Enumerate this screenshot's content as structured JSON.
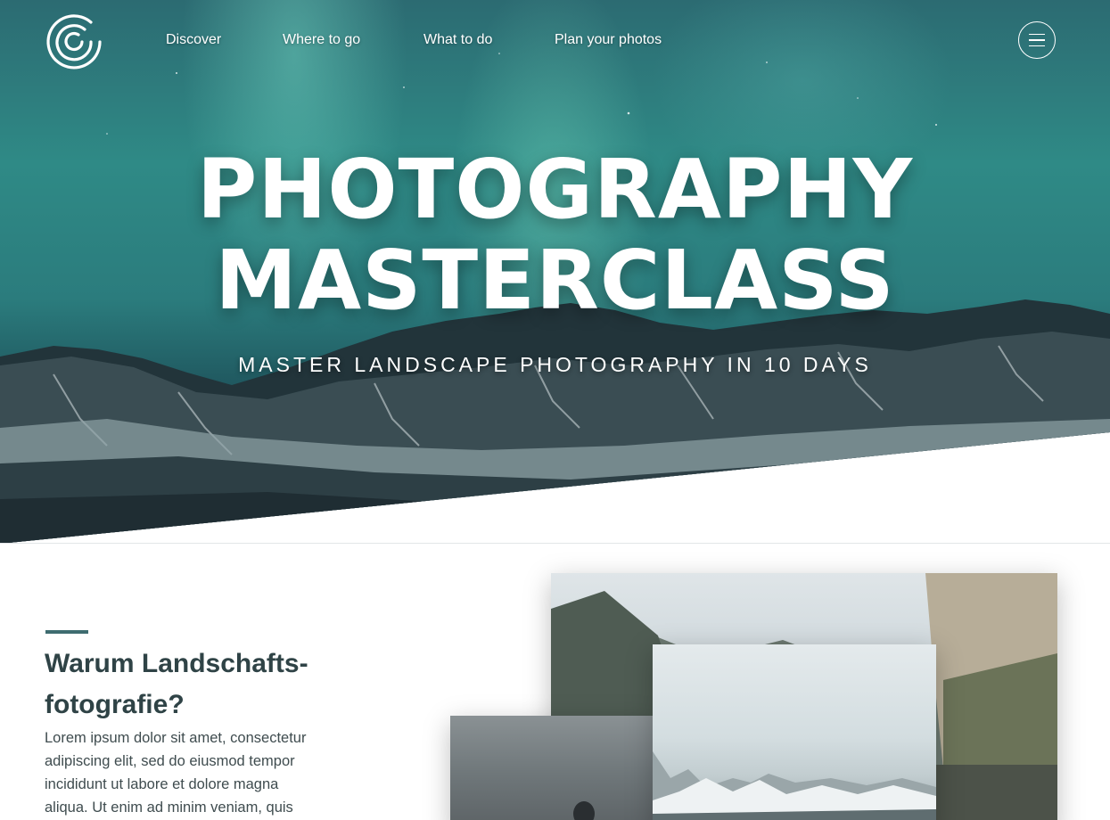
{
  "nav": {
    "logo_icon": "concentric-circles-logo-icon",
    "links": [
      "Discover",
      "Where to go",
      "What to do",
      "Plan your photos"
    ],
    "menu_icon": "hamburger-menu-icon"
  },
  "hero": {
    "title_line1": "PHOTOGRAPHY",
    "title_line2": "MASTERCLASS",
    "subtitle": "MASTER LANDSCAPE PHOTOGRAPHY IN 10 DAYS"
  },
  "intro": {
    "title_line1": "Warum Landschafts-",
    "title_line2": "fotografie?",
    "body": "Lorem ipsum dolor sit amet, consectetur adipiscing elit, sed do eiusmod tempor incididunt ut labore et dolore magna aliqua. Ut enim ad minim veniam, quis"
  },
  "colors": {
    "accent": "#3e6c70",
    "heading": "#2f4346",
    "body_text": "#3f4c4f",
    "hero_teal": "#2f8a86"
  }
}
